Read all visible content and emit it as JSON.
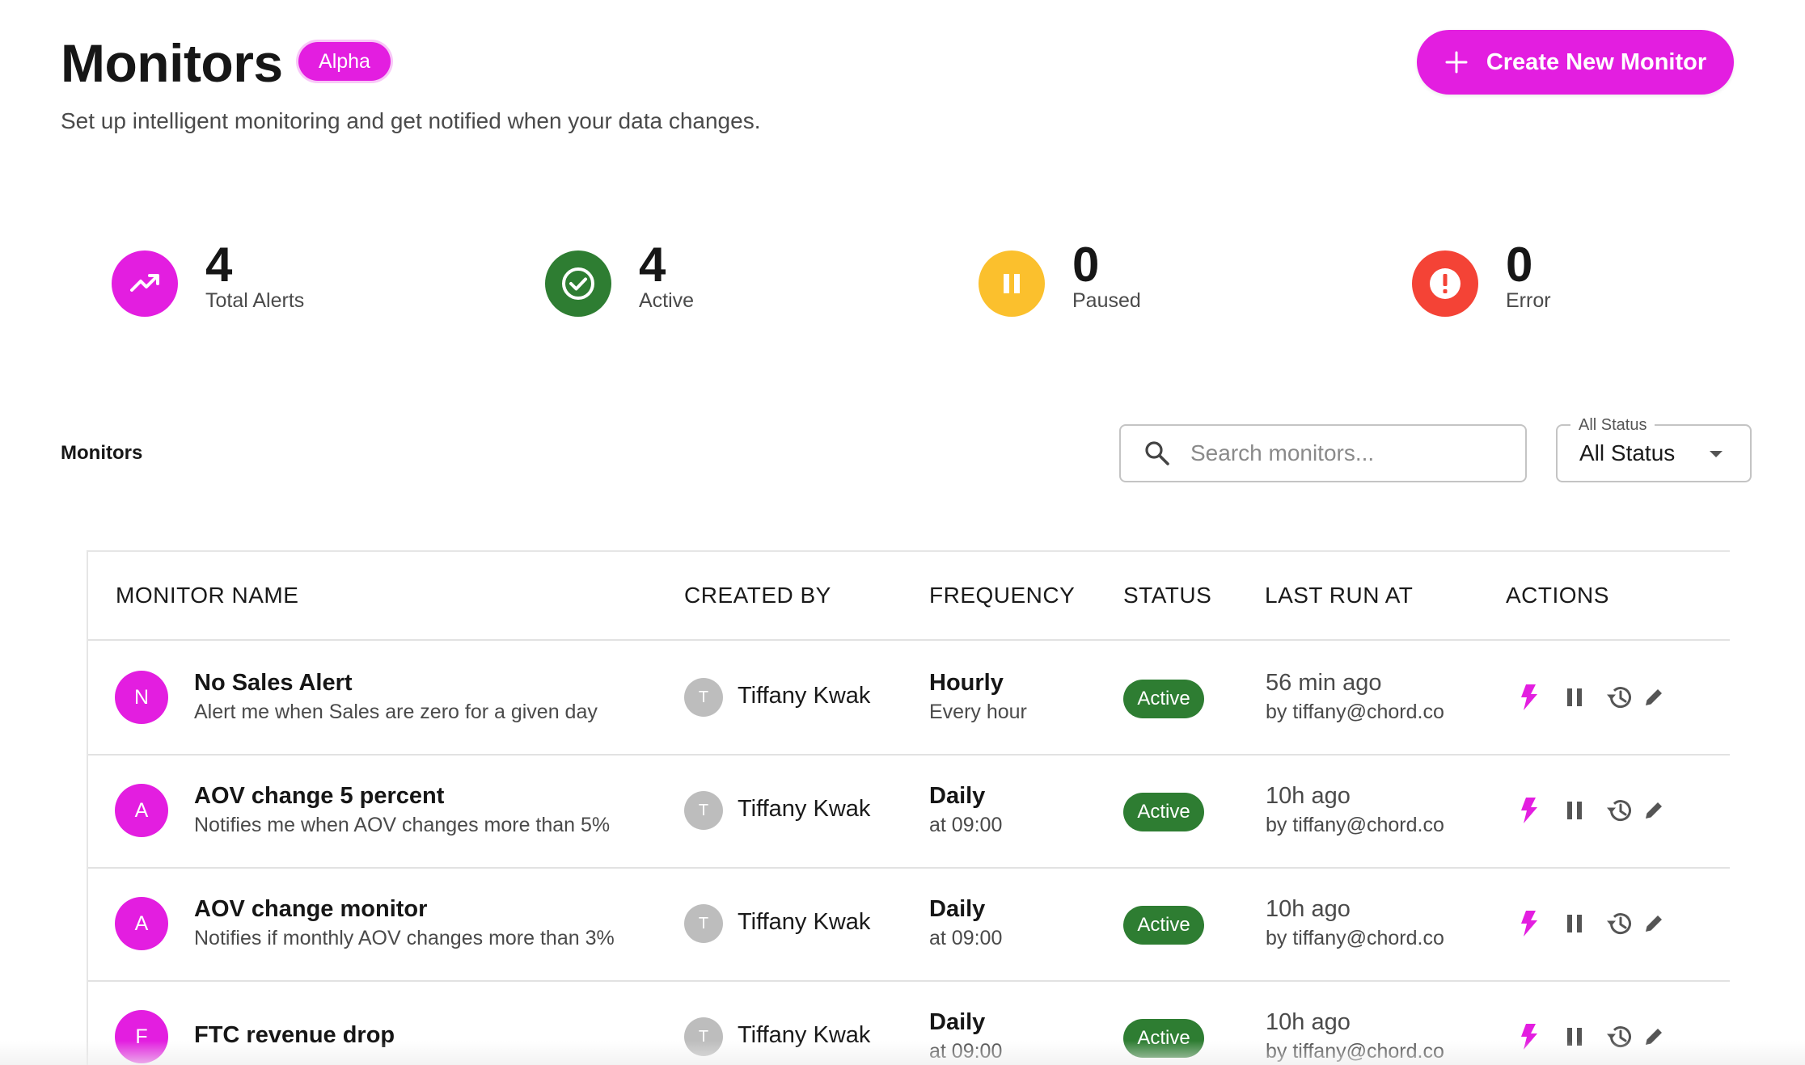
{
  "header": {
    "title": "Monitors",
    "badge": "Alpha",
    "subtitle": "Set up intelligent monitoring and get notified when your data changes.",
    "create_button_label": "Create New Monitor"
  },
  "stats": [
    {
      "value": "4",
      "label": "Total Alerts",
      "icon": "trending-up-icon",
      "color": "#e31ee0"
    },
    {
      "value": "4",
      "label": "Active",
      "icon": "check-icon",
      "color": "#2e7d32"
    },
    {
      "value": "0",
      "label": "Paused",
      "icon": "pause-icon",
      "color": "#fbc02d"
    },
    {
      "value": "0",
      "label": "Error",
      "icon": "exclamation-icon",
      "color": "#f44336"
    }
  ],
  "toolbar": {
    "section_label": "Monitors",
    "search_placeholder": "Search monitors...",
    "status_filter_label": "All Status",
    "status_filter_value": "All Status"
  },
  "table": {
    "columns": [
      "MONITOR NAME",
      "CREATED BY",
      "FREQUENCY",
      "STATUS",
      "LAST RUN AT",
      "ACTIONS"
    ],
    "rows": [
      {
        "avatar": "N",
        "name": "No Sales Alert",
        "description": "Alert me when Sales are zero for a given day",
        "creator_initial": "T",
        "creator": "Tiffany Kwak",
        "frequency": "Hourly",
        "frequency_detail": "Every hour",
        "status": "Active",
        "last_run": "56 min ago",
        "last_run_by": "by tiffany@chord.co"
      },
      {
        "avatar": "A",
        "name": "AOV change 5 percent",
        "description": "Notifies me when AOV changes more than 5%",
        "creator_initial": "T",
        "creator": "Tiffany Kwak",
        "frequency": "Daily",
        "frequency_detail": "at 09:00",
        "status": "Active",
        "last_run": "10h ago",
        "last_run_by": "by tiffany@chord.co"
      },
      {
        "avatar": "A",
        "name": "AOV change monitor",
        "description": "Notifies if monthly AOV changes more than 3%",
        "creator_initial": "T",
        "creator": "Tiffany Kwak",
        "frequency": "Daily",
        "frequency_detail": "at 09:00",
        "status": "Active",
        "last_run": "10h ago",
        "last_run_by": "by tiffany@chord.co"
      },
      {
        "avatar": "F",
        "name": "FTC revenue drop",
        "description": "",
        "creator_initial": "T",
        "creator": "Tiffany Kwak",
        "frequency": "Daily",
        "frequency_detail": "at 09:00",
        "status": "Active",
        "last_run": "10h ago",
        "last_run_by": "by tiffany@chord.co"
      }
    ]
  },
  "colors": {
    "accent": "#e31ee0",
    "active": "#2e7d32",
    "paused": "#fbc02d",
    "error": "#f44336",
    "action_icon": "#555555"
  }
}
